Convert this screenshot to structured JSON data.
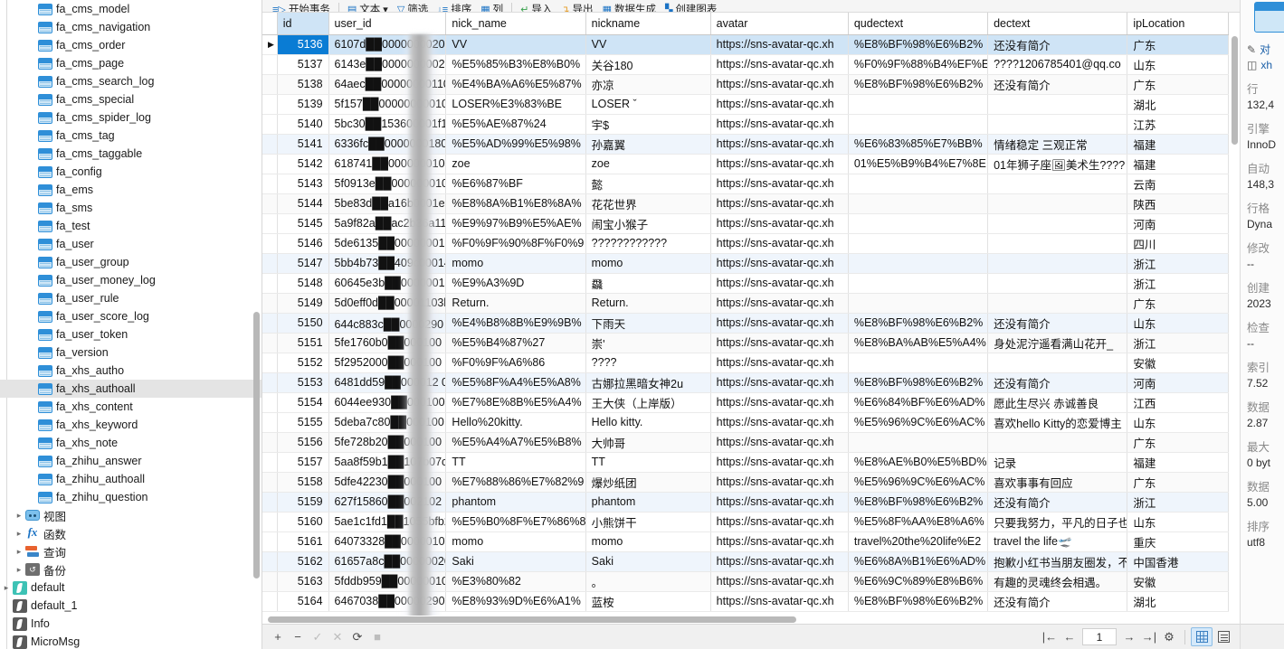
{
  "sidebar": {
    "tables": [
      "fa_cms_model",
      "fa_cms_navigation",
      "fa_cms_order",
      "fa_cms_page",
      "fa_cms_search_log",
      "fa_cms_special",
      "fa_cms_spider_log",
      "fa_cms_tag",
      "fa_cms_taggable",
      "fa_config",
      "fa_ems",
      "fa_sms",
      "fa_test",
      "fa_user",
      "fa_user_group",
      "fa_user_money_log",
      "fa_user_rule",
      "fa_user_score_log",
      "fa_user_token",
      "fa_version",
      "fa_xhs_autho",
      "fa_xhs_authoall",
      "fa_xhs_content",
      "fa_xhs_keyword",
      "fa_xhs_note",
      "fa_zhihu_answer",
      "fa_zhihu_authoall",
      "fa_zhihu_question"
    ],
    "selected_table": "fa_xhs_authoall",
    "groups": [
      {
        "label": "视图",
        "icon": "view-icon"
      },
      {
        "label": "函数",
        "icon": "function-icon"
      },
      {
        "label": "查询",
        "icon": "query-icon"
      },
      {
        "label": "备份",
        "icon": "backup-icon"
      }
    ],
    "connections": [
      {
        "label": "default",
        "expandable": true,
        "accent": "#3dc2b5"
      },
      {
        "label": "default_1",
        "expandable": false,
        "accent": "#5a5a5a"
      },
      {
        "label": "Info",
        "expandable": false,
        "accent": "#5a5a5a"
      },
      {
        "label": "MicroMsg",
        "expandable": false,
        "accent": "#5a5a5a"
      }
    ]
  },
  "toolbar": {
    "items": [
      {
        "label": "开始事务",
        "icon": "transaction-icon"
      },
      {
        "label": "文本",
        "icon": "text-icon",
        "caret": true
      },
      {
        "label": "筛选",
        "icon": "filter-icon"
      },
      {
        "label": "排序",
        "icon": "sort-icon"
      },
      {
        "label": "列",
        "icon": "columns-icon"
      },
      {
        "label": "导入",
        "icon": "import-icon"
      },
      {
        "label": "导出",
        "icon": "export-icon"
      },
      {
        "label": "数据生成",
        "icon": "data-generate-icon"
      },
      {
        "label": "创建图表",
        "icon": "create-chart-icon"
      }
    ]
  },
  "grid": {
    "columns": [
      "id",
      "user_id",
      "nick_name",
      "nickname",
      "avatar",
      "qudectext",
      "dectext",
      "ipLocation"
    ],
    "selected_column": "id",
    "selected_row_id": "5136",
    "rows": [
      {
        "id": "5136",
        "user_id": "6107d██000000002002",
        "nick_name": "VV",
        "nickname": "VV",
        "avatar": "https://sns-avatar-qc.xh",
        "qudectext": "%E8%BF%98%E6%B2%",
        "dectext": "还没有简介",
        "ipLocation": "广东"
      },
      {
        "id": "5137",
        "user_id": "6143e██000000000202",
        "nick_name": "%E5%85%B3%E8%B0%",
        "nickname": "关谷180",
        "avatar": "https://sns-avatar-qc.xh",
        "qudectext": "%F0%9F%88%B4%EF%E",
        "dectext": "????1206785401@qq.co",
        "ipLocation": "山东"
      },
      {
        "id": "5138",
        "user_id": "64aec██000000001100",
        "nick_name": "%E4%BA%A6%E5%87%",
        "nickname": "亦凉",
        "avatar": "https://sns-avatar-qc.xh",
        "qudectext": "%E8%BF%98%E6%B2%",
        "dectext": "还没有简介",
        "ipLocation": "广东"
      },
      {
        "id": "5139",
        "user_id": "5f157██000000000100",
        "nick_name": "LOSER%E3%83%BE",
        "nickname": "LOSER ˇ",
        "avatar": "https://sns-avatar-qc.xh",
        "qudectext": "",
        "dectext": "",
        "ipLocation": "湖北"
      },
      {
        "id": "5140",
        "user_id": "5bc30██153600001f18",
        "nick_name": "%E5%AE%87%24",
        "nickname": "宇$",
        "avatar": "https://sns-avatar-qc.xh",
        "qudectext": "",
        "dectext": "",
        "ipLocation": "江苏"
      },
      {
        "id": "5141",
        "user_id": "6336fc██000000018029",
        "nick_name": "%E5%AD%99%E5%98%",
        "nickname": "孙嘉翼",
        "avatar": "https://sns-avatar-qc.xh",
        "qudectext": "%E6%83%85%E7%BB%",
        "dectext": "情绪稳定 三观正常",
        "ipLocation": "福建"
      },
      {
        "id": "5142",
        "user_id": "618741██00000001000",
        "nick_name": "zoe",
        "nickname": "zoe",
        "avatar": "https://sns-avatar-qc.xh",
        "qudectext": "01%E5%B9%B4%E7%8E",
        "dectext": "01年狮子座🖼美术生????",
        "ipLocation": "福建"
      },
      {
        "id": "5143",
        "user_id": "5f0913e██0000000100",
        "nick_name": "%E6%87%BF",
        "nickname": "懿",
        "avatar": "https://sns-avatar-qc.xh",
        "qudectext": "",
        "dectext": "",
        "ipLocation": "云南"
      },
      {
        "id": "5144",
        "user_id": "5be83d██a16b0001e1",
        "nick_name": "%E8%8A%B1%E8%8A%",
        "nickname": "花花世界",
        "avatar": "https://sns-avatar-qc.xh",
        "qudectext": "",
        "dectext": "",
        "ipLocation": "陕西"
      },
      {
        "id": "5145",
        "user_id": "5a9f82a██ac2b36a114",
        "nick_name": "%E9%97%B9%E5%AE%",
        "nickname": "闹宝小猴子",
        "avatar": "https://sns-avatar-qc.xh",
        "qudectext": "",
        "dectext": "",
        "ipLocation": "河南"
      },
      {
        "id": "5146",
        "user_id": "5de6135██0000000100",
        "nick_name": "%F0%9F%90%8F%F0%9",
        "nickname": "????????????",
        "avatar": "https://sns-avatar-qc.xh",
        "qudectext": "",
        "dectext": "",
        "ipLocation": "四川"
      },
      {
        "id": "5147",
        "user_id": "5bb4b73██409c000141",
        "nick_name": "momo",
        "nickname": "momo",
        "avatar": "https://sns-avatar-qc.xh",
        "qudectext": "",
        "dectext": "",
        "ipLocation": "浙江"
      },
      {
        "id": "5148",
        "user_id": "60645e3b██000000100",
        "nick_name": "%E9%A3%9D",
        "nickname": "飝",
        "avatar": "https://sns-avatar-qc.xh",
        "qudectext": "",
        "dectext": "",
        "ipLocation": "浙江"
      },
      {
        "id": "5149",
        "user_id": "5d0eff0d██00001103b",
        "nick_name": "Return.",
        "nickname": "Return.",
        "avatar": "https://sns-avatar-qc.xh",
        "qudectext": "",
        "dectext": "",
        "ipLocation": "广东"
      },
      {
        "id": "5150",
        "user_id": "644c883c██0000290１",
        "nick_name": "%E4%B8%8B%E9%9B%",
        "nickname": "下雨天",
        "avatar": "https://sns-avatar-qc.xh",
        "qudectext": "%E8%BF%98%E6%B2%",
        "dectext": "还没有简介",
        "ipLocation": "山东"
      },
      {
        "id": "5151",
        "user_id": "5fe1760b0██000100",
        "nick_name": "%E5%B4%87%27",
        "nickname": "崇'",
        "avatar": "https://sns-avatar-qc.xh",
        "qudectext": "%E8%BA%AB%E5%A4%",
        "dectext": "身处泥泞遥看满山花开_",
        "ipLocation": "浙江"
      },
      {
        "id": "5152",
        "user_id": "5f2952000██000100",
        "nick_name": "%F0%9F%A6%86",
        "nickname": "????",
        "avatar": "https://sns-avatar-qc.xh",
        "qudectext": "",
        "dectext": "",
        "ipLocation": "安徽"
      },
      {
        "id": "5153",
        "user_id": "6481dd59██000012 03",
        "nick_name": "%E5%8F%A4%E5%A8%",
        "nickname": "古娜拉黑暗女神2u",
        "avatar": "https://sns-avatar-qc.xh",
        "qudectext": "%E8%BF%98%E6%B2%",
        "dectext": "还没有简介",
        "ipLocation": "河南"
      },
      {
        "id": "5154",
        "user_id": "6044ee930██000100",
        "nick_name": "%E7%8E%8B%E5%A4%",
        "nickname": "王大侠（上岸版）",
        "avatar": "https://sns-avatar-qc.xh",
        "qudectext": "%E6%84%BF%E6%AD%",
        "dectext": "愿此生尽兴 赤诚善良",
        "ipLocation": "江西"
      },
      {
        "id": "5155",
        "user_id": "5deba7c80██000100",
        "nick_name": "Hello%20kitty.",
        "nickname": "Hello kitty.",
        "avatar": "https://sns-avatar-qc.xh",
        "qudectext": "%E5%96%9C%E6%AC%",
        "dectext": "喜欢hello Kitty的恋爱博主",
        "ipLocation": "山东"
      },
      {
        "id": "5156",
        "user_id": "5fe728b20██000100",
        "nick_name": "%E5%A4%A7%E5%B8%",
        "nickname": "大帅哥",
        "avatar": "https://sns-avatar-qc.xh",
        "qudectext": "",
        "dectext": "",
        "ipLocation": "广东"
      },
      {
        "id": "5157",
        "user_id": "5aa8f59b1██107b07ce",
        "nick_name": "TT",
        "nickname": "TT",
        "avatar": "https://sns-avatar-qc.xh",
        "qudectext": "%E8%AE%B0%E5%BD%",
        "dectext": "记录",
        "ipLocation": "福建"
      },
      {
        "id": "5158",
        "user_id": "5dfe42230██000100",
        "nick_name": "%E7%88%86%E7%82%9",
        "nickname": "爆炒纸团",
        "avatar": "https://sns-avatar-qc.xh",
        "qudectext": "%E5%96%9C%E6%AC%",
        "dectext": "喜欢事事有回应",
        "ipLocation": "广东"
      },
      {
        "id": "5159",
        "user_id": "627f15860██002102",
        "nick_name": "phantom",
        "nickname": "phantom",
        "avatar": "https://sns-avatar-qc.xh",
        "qudectext": "%E8%BF%98%E6%B2%",
        "dectext": "还没有简介",
        "ipLocation": "浙江"
      },
      {
        "id": "5160",
        "user_id": "5ae1c1fd1██1055bfb2",
        "nick_name": "%E5%B0%8F%E7%86%8",
        "nickname": "小熊饼干",
        "avatar": "https://sns-avatar-qc.xh",
        "qudectext": "%E5%8F%AA%E8%A6%",
        "dectext": "只要我努力，平凡的日子也",
        "ipLocation": "山东"
      },
      {
        "id": "5161",
        "user_id": "64073328██000001002",
        "nick_name": "momo",
        "nickname": "momo",
        "avatar": "https://sns-avatar-qc.xh",
        "qudectext": "travel%20the%20life%E2",
        "dectext": "travel the life🛫",
        "ipLocation": "重庆"
      },
      {
        "id": "5162",
        "user_id": "61657a8c██000000202",
        "nick_name": "Saki",
        "nickname": "Saki",
        "avatar": "https://sns-avatar-qc.xh",
        "qudectext": "%E6%8A%B1%E6%AD%",
        "dectext": "抱歉小红书当朋友圈发，不",
        "ipLocation": "中国香港"
      },
      {
        "id": "5163",
        "user_id": "5fddb959██000000100",
        "nick_name": "%E3%80%82",
        "nickname": "。",
        "avatar": "https://sns-avatar-qc.xh",
        "qudectext": "%E6%9C%89%E8%B6%",
        "dectext": "有趣的灵魂终会相遇。",
        "ipLocation": "安徽"
      },
      {
        "id": "5164",
        "user_id": "6467038██000002901",
        "nick_name": "%E8%93%9D%E6%A1%",
        "nickname": "蓝桉",
        "avatar": "https://sns-avatar-qc.xh",
        "qudectext": "%E8%BF%98%E6%B2%",
        "dectext": "还没有简介",
        "ipLocation": "湖北"
      }
    ]
  },
  "statusbar": {
    "add_label": "+",
    "remove_label": "−",
    "confirm_label": "✓",
    "cancel_label": "✕",
    "refresh_label": "⟳",
    "stop_label": "■",
    "first_label": "|←",
    "prev_label": "←",
    "page_value": "1",
    "next_label": "→",
    "last_label": "→|",
    "settings_label": "⚙",
    "view_grid_label": "grid-view-icon",
    "view_form_label": "form-view-icon"
  },
  "rightpanel": {
    "links": [
      {
        "label": "对",
        "icon": "edit-object-icon"
      },
      {
        "label": "xh",
        "icon": "database-icon"
      }
    ],
    "fields": [
      {
        "key": "行",
        "value": "132,4"
      },
      {
        "key": "引擎",
        "value": "InnoD"
      },
      {
        "key": "自动",
        "value": "148,3"
      },
      {
        "key": "行格",
        "value": "Dyna"
      },
      {
        "key": "修改",
        "value": "--"
      },
      {
        "key": "创建",
        "value": "2023"
      },
      {
        "key": "检查",
        "value": "--"
      },
      {
        "key": "索引",
        "value": "7.52"
      },
      {
        "key": "数据",
        "value": "2.87"
      },
      {
        "key": "最大",
        "value": "0 byt"
      },
      {
        "key": "数据",
        "value": "5.00"
      },
      {
        "key": "排序",
        "value": "utf8"
      }
    ]
  }
}
